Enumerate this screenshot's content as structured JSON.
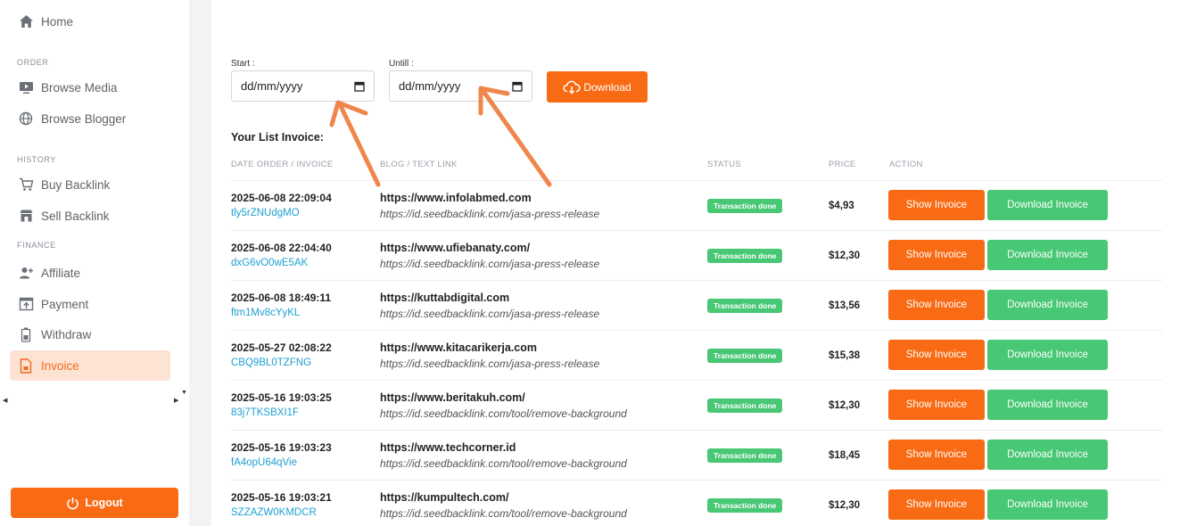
{
  "sidebar": {
    "home": "Home",
    "section_order": "ORDER",
    "browse_media": "Browse Media",
    "browse_blogger": "Browse Blogger",
    "section_history": "HISTORY",
    "buy_backlink": "Buy Backlink",
    "sell_backlink": "Sell Backlink",
    "section_finance": "FINANCE",
    "affiliate": "Affiliate",
    "payment": "Payment",
    "withdraw": "Withdraw",
    "invoice": "Invoice",
    "logout": "Logout"
  },
  "filter": {
    "start_label": "Start :",
    "until_label": "Untill :",
    "start_value": "dd/mm/yyyy",
    "until_value": "dd/mm/yyyy",
    "download_label": "Download"
  },
  "list": {
    "title": "Your List Invoice:",
    "headers": {
      "date": "DATE ORDER / INVOICE",
      "blog": "BLOG / TEXT LINK",
      "status": "STATUS",
      "price": "PRICE",
      "action": "ACTION"
    },
    "show_label": "Show Invoice",
    "download_label": "Download Invoice",
    "rows": [
      {
        "date": "2025-06-08 22:09:04",
        "invoice": "tly5rZNUdgMO",
        "site": "https://www.infolabmed.com",
        "link": "https://id.seedbacklink.com/jasa-press-release",
        "status": "Transaction done",
        "price": "$4,93"
      },
      {
        "date": "2025-06-08 22:04:40",
        "invoice": "dxG6vO0wE5AK",
        "site": "https://www.ufiebanaty.com/",
        "link": "https://id.seedbacklink.com/jasa-press-release",
        "status": "Transaction done",
        "price": "$12,30"
      },
      {
        "date": "2025-06-08 18:49:11",
        "invoice": "ftm1Mv8cYyKL",
        "site": "https://kuttabdigital.com",
        "link": "https://id.seedbacklink.com/jasa-press-release",
        "status": "Transaction done",
        "price": "$13,56"
      },
      {
        "date": "2025-05-27 02:08:22",
        "invoice": "CBQ9BL0TZFNG",
        "site": "https://www.kitacarikerja.com",
        "link": "https://id.seedbacklink.com/jasa-press-release",
        "status": "Transaction done",
        "price": "$15,38"
      },
      {
        "date": "2025-05-16 19:03:25",
        "invoice": "83j7TKSBXI1F",
        "site": "https://www.beritakuh.com/",
        "link": "https://id.seedbacklink.com/tool/remove-background",
        "status": "Transaction done",
        "price": "$12,30"
      },
      {
        "date": "2025-05-16 19:03:23",
        "invoice": "fA4opU64qVie",
        "site": "https://www.techcorner.id",
        "link": "https://id.seedbacklink.com/tool/remove-background",
        "status": "Transaction done",
        "price": "$18,45"
      },
      {
        "date": "2025-05-16 19:03:21",
        "invoice": "SZZAZW0KMDCR",
        "site": "https://kumpultech.com/",
        "link": "https://id.seedbacklink.com/tool/remove-background",
        "status": "Transaction done",
        "price": "$12,30"
      }
    ]
  },
  "colors": {
    "accent": "#f86a13",
    "success": "#48c774",
    "link": "#1ea0d2",
    "active_bg": "#fde3d4"
  }
}
